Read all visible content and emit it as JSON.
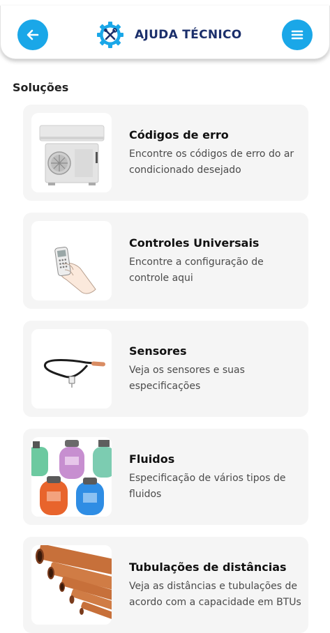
{
  "header": {
    "title": "AJUDA TÉCNICO",
    "back_icon": "arrow-left-icon",
    "menu_icon": "hamburger-menu-icon",
    "logo_icon": "gear-tools-icon",
    "accent_color": "#1aa7e8",
    "title_color": "#1b2f6b"
  },
  "section": {
    "title": "Soluções"
  },
  "cards": [
    {
      "title": "Códigos de erro",
      "description": "Encontre os códigos de erro do ar condicionado desejado",
      "image": "air-conditioner-image"
    },
    {
      "title": "Controles Universais",
      "description": "Encontre a configuração de controle aqui",
      "image": "remote-control-image"
    },
    {
      "title": "Sensores",
      "description": "Veja os sensores e suas especificações",
      "image": "sensor-cable-image"
    },
    {
      "title": "Fluidos",
      "description": "Especificação de vários tipos de fluidos",
      "image": "refrigerant-cylinders-image"
    },
    {
      "title": "Tubulações de distâncias",
      "description": "Veja as distâncias e tubulações de acordo com a capacidade em BTUs",
      "image": "copper-pipes-image"
    }
  ]
}
